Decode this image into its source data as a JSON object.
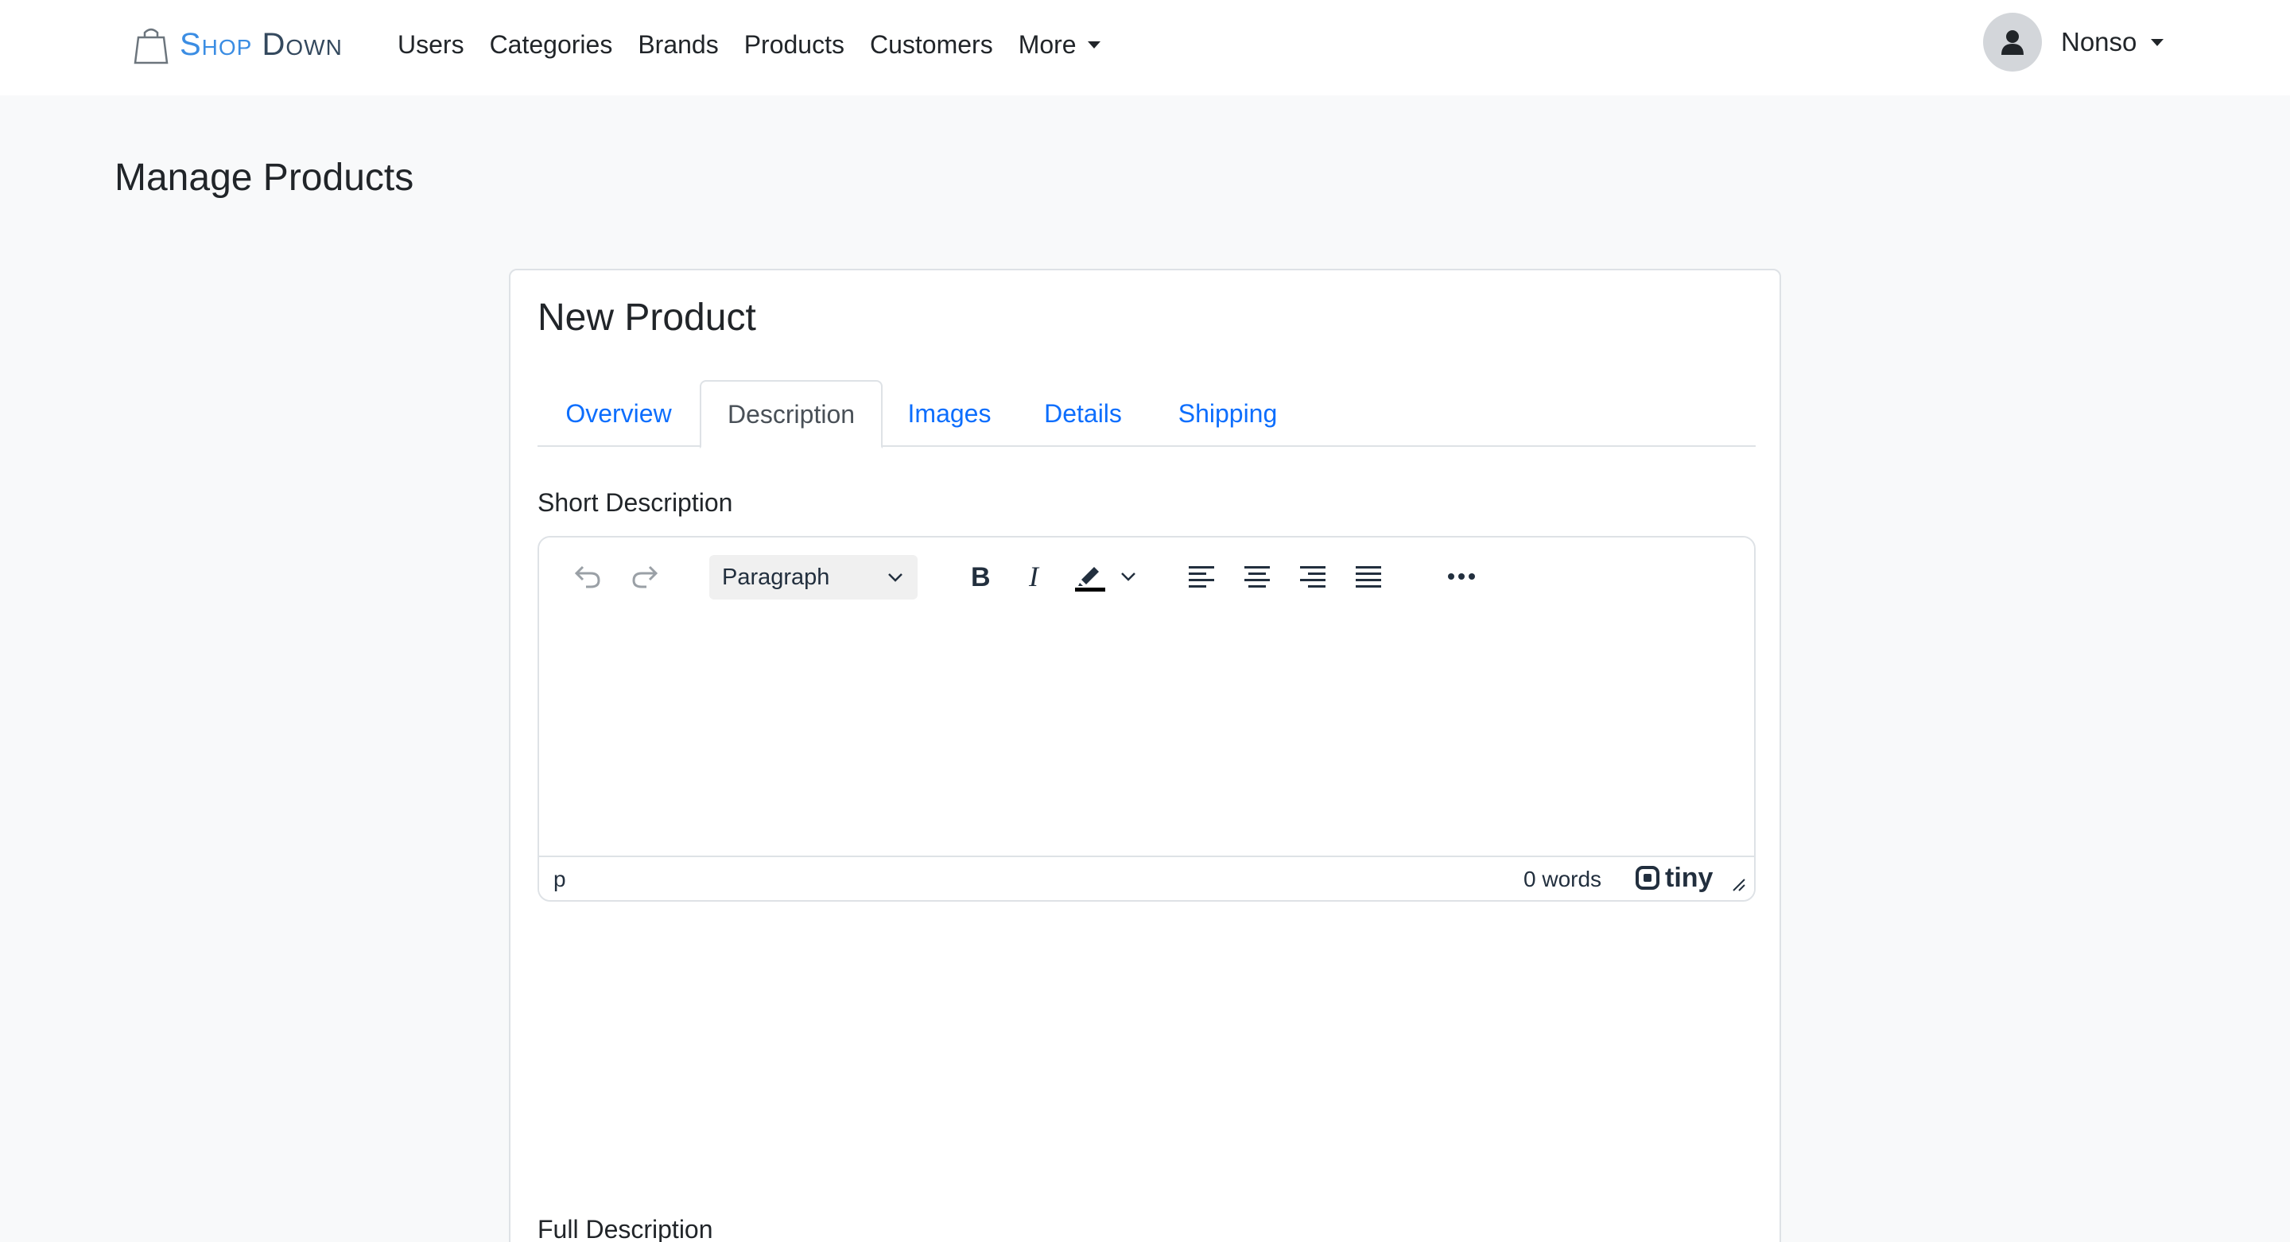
{
  "navbar": {
    "brand": {
      "part1": "Shop",
      "part2": "Down"
    },
    "links": [
      "Users",
      "Categories",
      "Brands",
      "Products",
      "Customers"
    ],
    "more_label": "More",
    "user_name": "Nonso"
  },
  "page": {
    "title": "Manage Products"
  },
  "form": {
    "title": "New Product",
    "tabs": [
      {
        "label": "Overview",
        "active": false
      },
      {
        "label": "Description",
        "active": true
      },
      {
        "label": "Images",
        "active": false
      },
      {
        "label": "Details",
        "active": false
      },
      {
        "label": "Shipping",
        "active": false
      }
    ],
    "short_description_label": "Short Description",
    "full_description_label": "Full Description",
    "editor": {
      "block_format": "Paragraph",
      "status_path": "p",
      "word_count": "0 words",
      "branding": "tiny",
      "toolbar_icons": [
        "undo-icon",
        "redo-icon",
        "bold-icon",
        "italic-icon",
        "highlight-icon",
        "align-left-icon",
        "align-center-icon",
        "align-right-icon",
        "align-justify-icon",
        "more-icon"
      ]
    }
  },
  "colors": {
    "brand_blue": "#3b8de3",
    "brand_dark": "#34495e",
    "link": "#0d6efd",
    "page_bg": "#f8f9fa"
  }
}
